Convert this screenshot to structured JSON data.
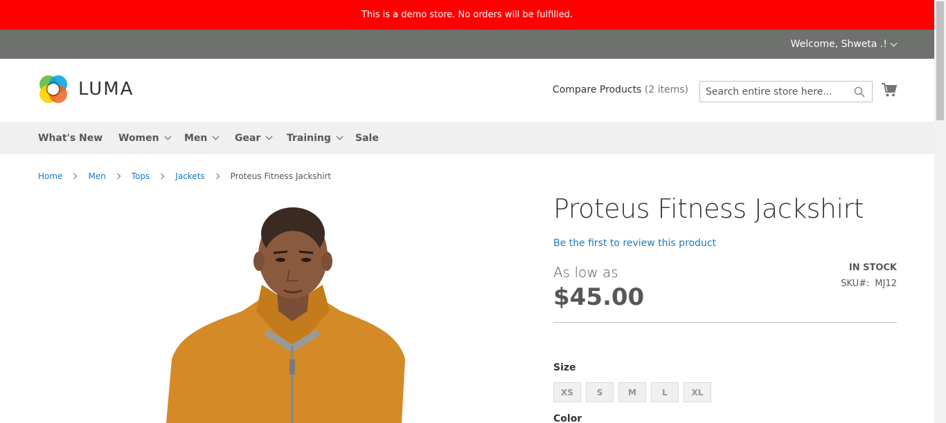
{
  "demo_notice": "This is a demo store. No orders will be fulfilled.",
  "header": {
    "welcome": "Welcome, Shweta .!",
    "logo_text": "LUMA",
    "compare_label": "Compare Products",
    "compare_count": "(2 items)",
    "search_placeholder": "Search entire store here..."
  },
  "nav": {
    "items": [
      {
        "label": "What's New"
      },
      {
        "label": "Women"
      },
      {
        "label": "Men"
      },
      {
        "label": "Gear"
      },
      {
        "label": "Training"
      },
      {
        "label": "Sale"
      }
    ]
  },
  "breadcrumbs": {
    "items": [
      "Home",
      "Men",
      "Tops",
      "Jackets"
    ],
    "current": "Proteus Fitness Jackshirt"
  },
  "product": {
    "title": "Proteus Fitness Jackshirt",
    "review_link": "Be the first to review this product",
    "price_prefix": "As low as",
    "price": "$45.00",
    "stock": "IN STOCK",
    "sku_label": "SKU#:",
    "sku_value": "MJ12",
    "size_label": "Size",
    "sizes": [
      "XS",
      "S",
      "M",
      "L",
      "XL"
    ],
    "color_label": "Color"
  },
  "colors": {
    "demo_bar": "#ff0000",
    "panel_bar": "#6e716e",
    "nav_bg": "#f0f0f0",
    "link": "#1979c3",
    "product_shirt": "#d48a26"
  }
}
